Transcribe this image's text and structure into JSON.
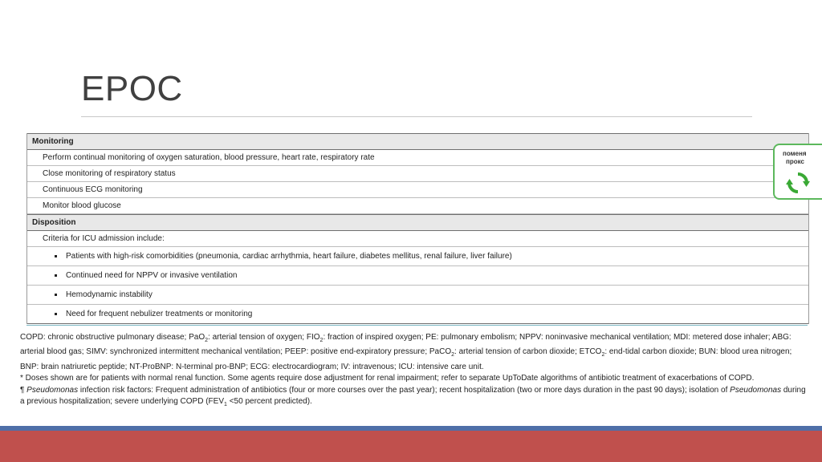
{
  "slide": {
    "title": "EPOC"
  },
  "table": {
    "sections": [
      {
        "header": "Monitoring",
        "rows": [
          "Perform continual monitoring of oxygen saturation, blood pressure, heart rate, respiratory rate",
          "Close monitoring of respiratory status",
          "Continuous ECG monitoring",
          "Monitor blood glucose"
        ]
      },
      {
        "header": "Disposition",
        "rows": [
          "Criteria for ICU admission include:"
        ],
        "bullets": [
          "Patients with high-risk comorbidities (pneumonia, cardiac arrhythmia, heart failure, diabetes mellitus, renal failure, liver failure)",
          "Continued need for NPPV or invasive ventilation",
          "Hemodynamic instability",
          "Need for frequent nebulizer treatments or monitoring"
        ]
      }
    ]
  },
  "footnotes": {
    "abbr_a": "COPD: chronic obstructive pulmonary disease; PaO",
    "abbr_a_sub": "2",
    "abbr_b": ": arterial tension of oxygen; FIO",
    "abbr_b_sub": "2",
    "abbr_c": ": fraction of inspired oxygen; PE: pulmonary embolism; NPPV: noninvasive mechanical ventilation; MDI: metered dose inhaler; ABG: arterial blood gas; SIMV: synchronized intermittent mechanical ventilation; PEEP: positive end-expiratory pressure; PaCO",
    "abbr_c_sub": "2",
    "abbr_d": ": arterial tension of carbon dioxide; ETCO",
    "abbr_d_sub": "2",
    "abbr_e": ": end-tidal carbon dioxide; BUN: blood urea nitrogen; BNP: brain natriuretic peptide; NT-ProBNP: N-terminal pro-BNP; ECG: electrocardiogram; IV: intravenous; ICU: intensive care unit.",
    "doses": "* Doses shown are for patients with normal renal function. Some agents require dose adjustment for renal impairment; refer to separate UpToDate algorithms of antibiotic treatment of exacerbations of COPD.",
    "pseudo_mark": "¶ ",
    "pseudo_italic_1": "Pseudomonas",
    "pseudo_text_1": " infection risk factors: Frequent administration of antibiotics (four or more courses over the past year); recent hospitalization (two or more days duration in the past 90 days); isolation of ",
    "pseudo_italic_2": "Pseudomonas",
    "pseudo_text_2": " during a previous hospitalization; severe underlying COPD (FEV",
    "pseudo_sub": "1",
    "pseudo_text_3": " <50 percent predicted)."
  },
  "proxy_widget": {
    "line1": "поменя",
    "line2": "прокс",
    "icon": "refresh-icon",
    "color": "#3aa935"
  },
  "colors": {
    "band_blue": "#4f6fa8",
    "band_red": "#c0504d",
    "section_bg": "#e8e8e8"
  }
}
